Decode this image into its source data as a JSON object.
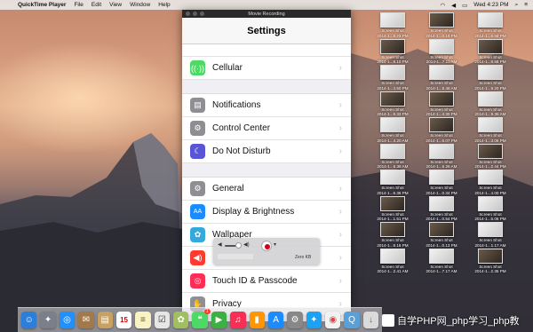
{
  "menubar": {
    "app_name": "QuickTime Player",
    "menus": [
      "File",
      "Edit",
      "View",
      "Window",
      "Help"
    ],
    "clock": "Wed 4:23 PM"
  },
  "window": {
    "title": "Movie Recording"
  },
  "settings": {
    "header": "Settings",
    "rows": {
      "cellular": "Cellular",
      "notifications": "Notifications",
      "control_center": "Control Center",
      "do_not_disturb": "Do Not Disturb",
      "general": "General",
      "display": "Display & Brightness",
      "wallpaper": "Wallpaper",
      "touch_id": "Touch ID & Passcode",
      "privacy": "Privacy"
    }
  },
  "hud": {
    "size": "Zero KB"
  },
  "desktop_icons": [
    {
      "title": "Screen Shot",
      "date": "2014-1...8.23 PM"
    },
    {
      "title": "Screen Shot",
      "date": "2014-1...0.19 PM"
    },
    {
      "title": "Screen Shot",
      "date": "2014-1...6.58 PM"
    },
    {
      "title": "Screen Shot",
      "date": "2014-1...8.10 PM"
    },
    {
      "title": "Screen Shot",
      "date": "2014-1...7.11 AM"
    },
    {
      "title": "Screen Shot",
      "date": "2014-1...8.58 PM"
    },
    {
      "title": "Screen Shot",
      "date": "2014-1...4.50 PM"
    },
    {
      "title": "Screen Shot",
      "date": "2014-1...5.48 AM"
    },
    {
      "title": "Screen Shot",
      "date": "2014-1...9.20 PM"
    },
    {
      "title": "Screen Shot",
      "date": "2014-1...9.33 PM"
    },
    {
      "title": "Screen Shot",
      "date": "2014-1...4.30 PM"
    },
    {
      "title": "Screen Shot",
      "date": "2014-1...9.36 AM"
    },
    {
      "title": "Screen Shot",
      "date": "2014-1...4.20 AM"
    },
    {
      "title": "Screen Shot",
      "date": "2014-1...6.07 PM"
    },
    {
      "title": "Screen Shot",
      "date": "2014-1...3.06 PM"
    },
    {
      "title": "Screen Shot",
      "date": "2014-1...6.36 AM"
    },
    {
      "title": "Screen Shot",
      "date": "2014-1...5.26 AM"
    },
    {
      "title": "Screen Shot",
      "date": "2014-1...2.44 PM"
    },
    {
      "title": "Screen Shot",
      "date": "2014-1...6.36 PM"
    },
    {
      "title": "Screen Shot",
      "date": "2014-1...0.34 PM"
    },
    {
      "title": "Screen Shot",
      "date": "2014-1...4.00 PM"
    },
    {
      "title": "Screen Shot",
      "date": "2014-1...1.51 PM"
    },
    {
      "title": "Screen Shot",
      "date": "2014-1...0.54 PM"
    },
    {
      "title": "Screen Shot",
      "date": "2014-1...5.06 PM"
    },
    {
      "title": "Screen Shot",
      "date": "2014-1...9.16 PM"
    },
    {
      "title": "Screen Shot",
      "date": "2014-1...0.13 PM"
    },
    {
      "title": "Screen Shot",
      "date": "2014-1...1.17 AM"
    },
    {
      "title": "Screen Shot",
      "date": "2014-1...2.41 AM"
    },
    {
      "title": "Screen Shot",
      "date": "2014-1...7.17 AM"
    },
    {
      "title": "Screen Shot",
      "date": "2014-1...2.35 PM"
    }
  ],
  "dock": {
    "calendar_day": "15",
    "calendar_badge": "1"
  },
  "watermark": {
    "text": "自学PHP网_php学习_php教"
  },
  "colors": {
    "ios_green": "#4cd964",
    "ios_red": "#ff3b30",
    "ios_gray": "#8e8e93",
    "ios_purple": "#5856d6",
    "ios_blue": "#1a8cff",
    "ios_cyan": "#34aadc",
    "ios_pink": "#ff2d55"
  }
}
